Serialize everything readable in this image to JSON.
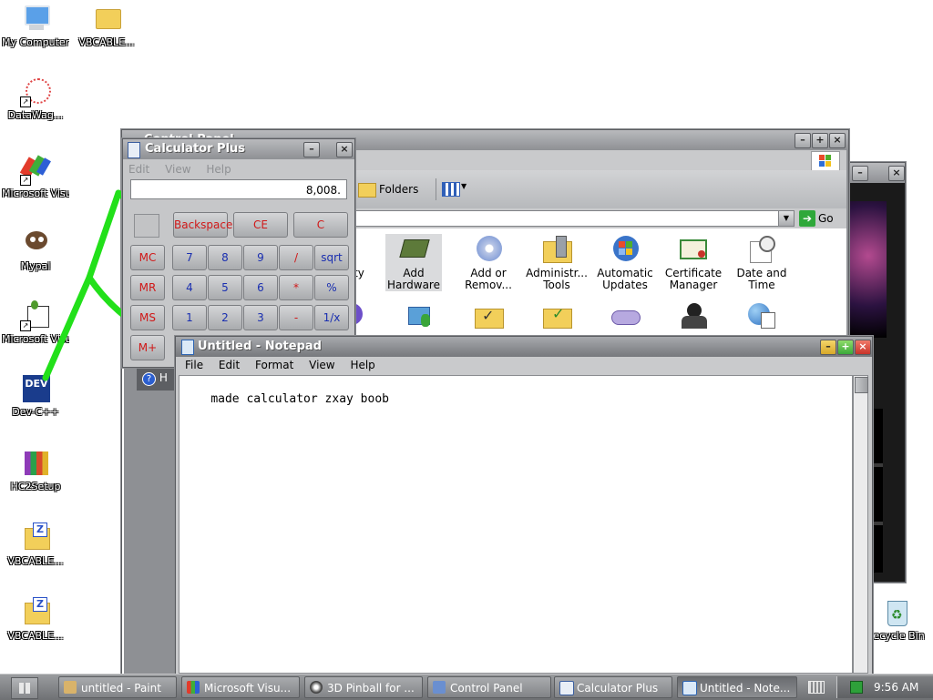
{
  "desktop": {
    "icons": [
      {
        "label": "My Computer",
        "icon": "my-computer-icon"
      },
      {
        "label": "VBCABLE...",
        "icon": "folder-icon"
      },
      {
        "label": "DataWag...",
        "icon": "datawag-icon"
      },
      {
        "label": "Microsoft Visual C...",
        "icon": "visual-cpp-icon"
      },
      {
        "label": "Mypal",
        "icon": "mypal-icon"
      },
      {
        "label": "Microsoft Visual Ba...",
        "icon": "visual-basic-icon"
      },
      {
        "label": "Dev-C++",
        "icon": "devcpp-icon"
      },
      {
        "label": "HC2Setup",
        "icon": "setup-icon"
      },
      {
        "label": "VBCABLE...",
        "icon": "zip-folder-icon"
      },
      {
        "label": "VBCABLE...",
        "icon": "zip-folder-icon"
      },
      {
        "label": "Recycle Bin",
        "icon": "recycle-bin-icon"
      }
    ]
  },
  "control_panel": {
    "title": "Control Panel",
    "toolbar": {
      "folders_label": "Folders"
    },
    "address_fragment": "p",
    "go_label": "Go",
    "items_row1": [
      {
        "label": "...bility ...ons",
        "icon": "accessibility-icon"
      },
      {
        "label": "Add Hardware",
        "icon": "add-hardware-icon"
      },
      {
        "label": "Add or Remov...",
        "icon": "add-remove-icon"
      },
      {
        "label": "Administr... Tools",
        "icon": "admin-tools-icon"
      },
      {
        "label": "Automatic Updates",
        "icon": "windows-update-icon"
      },
      {
        "label": "Certificate Manager",
        "icon": "certificate-icon"
      },
      {
        "label": "Date and Time",
        "icon": "date-time-icon"
      }
    ],
    "sidebar_help_fragment": "H"
  },
  "calculator": {
    "title": "Calculator Plus",
    "menu": [
      "Edit",
      "View",
      "Help"
    ],
    "display": "8,008.",
    "row0": [
      "Backspace",
      "CE",
      "C"
    ],
    "memory": [
      "MC",
      "MR",
      "MS",
      "M+"
    ],
    "row1": [
      "7",
      "8",
      "9",
      "/",
      "sqrt"
    ],
    "row2": [
      "4",
      "5",
      "6",
      "*",
      "%"
    ],
    "row3": [
      "1",
      "2",
      "3",
      "-",
      "1/x"
    ]
  },
  "notepad": {
    "title": "Untitled - Notepad",
    "menu": [
      "File",
      "Edit",
      "Format",
      "View",
      "Help"
    ],
    "content": "made calculator zxay boob"
  },
  "taskbar": {
    "items": [
      {
        "label": "untitled - Paint",
        "icon": "paint-icon"
      },
      {
        "label": "Microsoft Visu...",
        "icon": "visual-studio-icon"
      },
      {
        "label": "3D Pinball for ...",
        "icon": "pinball-icon"
      },
      {
        "label": "Control Panel",
        "icon": "control-panel-icon"
      },
      {
        "label": "Calculator Plus",
        "icon": "calculator-icon"
      },
      {
        "label": "Untitled - Note...",
        "icon": "notepad-icon"
      }
    ],
    "clock": "9:56 AM"
  },
  "colors": {
    "scribble": "#22e01a",
    "accent_red": "#d01818",
    "key_blue": "#1a2fb0"
  }
}
